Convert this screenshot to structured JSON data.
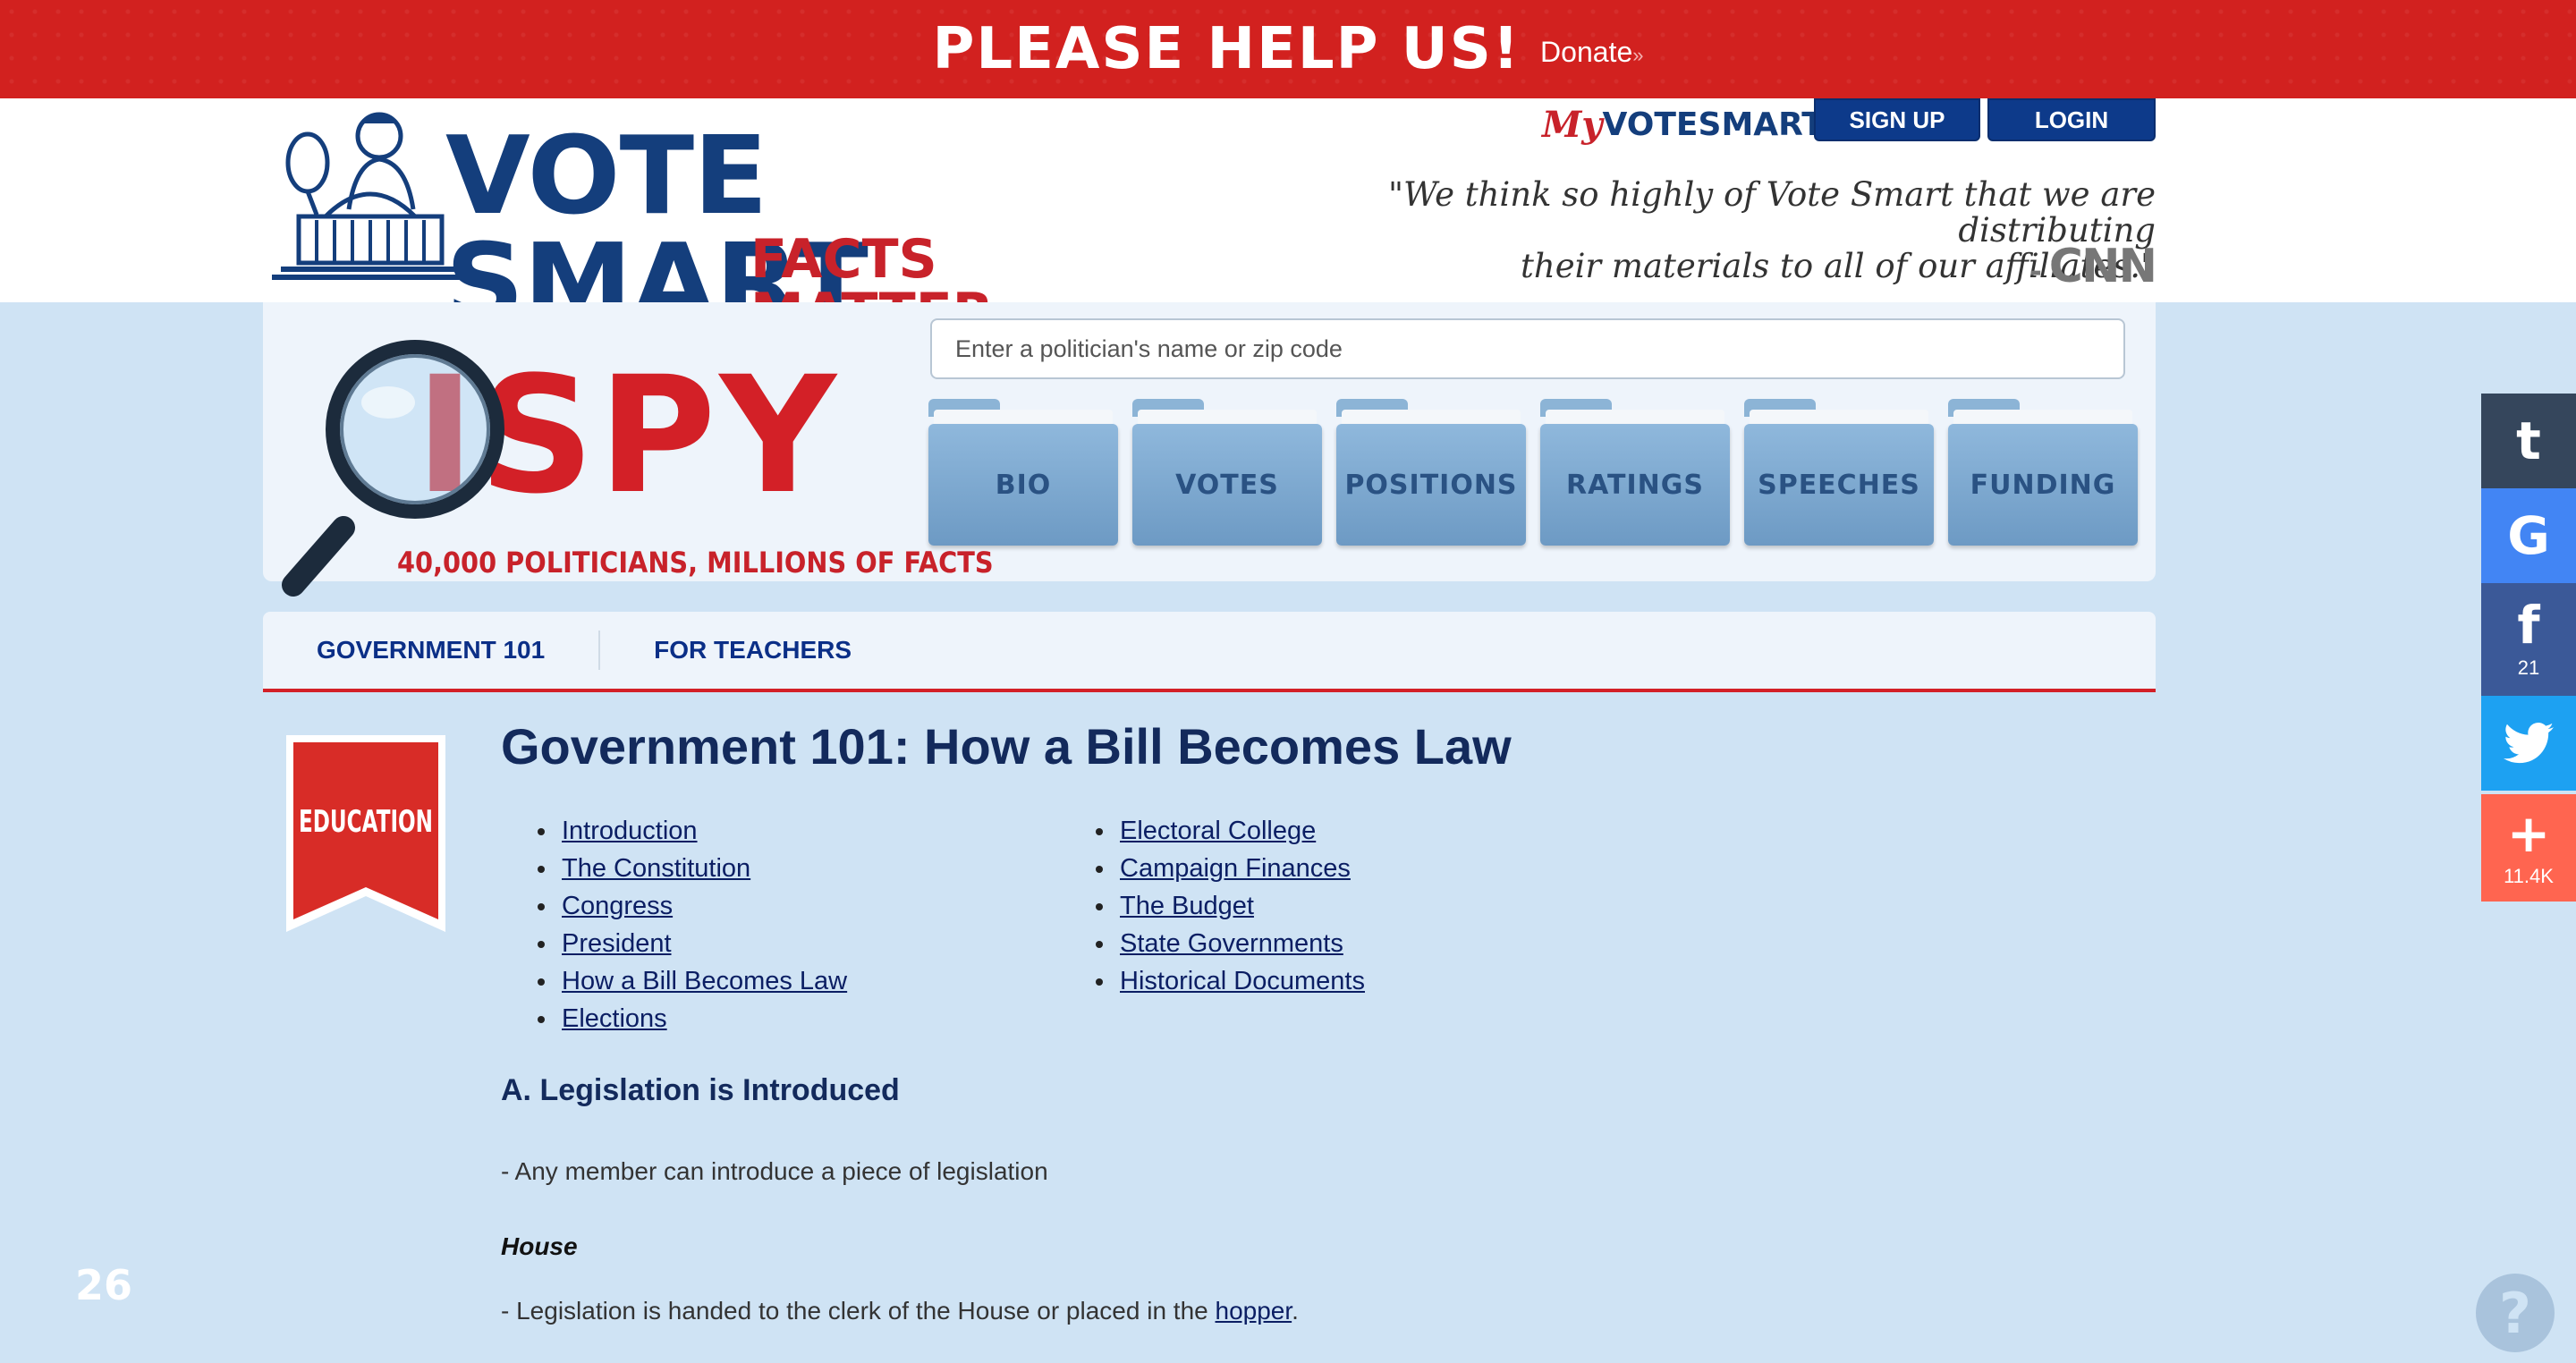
{
  "banner": {
    "headline": "PLEASE HELP US!",
    "donate_label": "Donate",
    "donate_arrow": "»"
  },
  "header": {
    "logo": {
      "line1": "VOTE SMART",
      "line2": "FACTS MATTER"
    },
    "my_votesmart": {
      "my": "My",
      "rest": "VOTESMART"
    },
    "signup_label": "SIGN UP",
    "login_label": "LOGIN",
    "quote_line1": "\"We think so highly of Vote Smart that we are distributing",
    "quote_line2": "their materials to all of our affiliates.\"",
    "quote_source_prefix": "- ",
    "quote_source": "CNN"
  },
  "ispy": {
    "word": "ISPY",
    "tagline": "40,000 POLITICIANS, MILLIONS OF FACTS",
    "search_placeholder": "Enter a politician's name or zip code",
    "folders": [
      "BIO",
      "VOTES",
      "POSITIONS",
      "RATINGS",
      "SPEECHES",
      "FUNDING"
    ]
  },
  "subnav": {
    "items": [
      "GOVERNMENT 101",
      "FOR TEACHERS"
    ]
  },
  "badge": {
    "label": "EDUCATION"
  },
  "content": {
    "title": "Government 101: How a Bill Becomes Law",
    "toc_left": [
      "Introduction",
      "The Constitution",
      "Congress",
      "President",
      "How a Bill Becomes Law",
      "Elections"
    ],
    "toc_right": [
      "Electoral College",
      "Campaign Finances",
      "The Budget",
      "State Governments",
      "Historical Documents"
    ],
    "section_heading": "A. Legislation is Introduced",
    "para1": "- Any member can introduce a piece of legislation",
    "house_label": "House",
    "para2_prefix": "- Legislation is handed to the clerk of the House or placed in the ",
    "para2_link": "hopper",
    "para2_suffix": "."
  },
  "share": {
    "tumblr_glyph": "t",
    "google_glyph": "G",
    "facebook_glyph": "f",
    "facebook_count": "21",
    "twitter_glyph": "🐦",
    "more_glyph": "+",
    "more_count": "11.4K"
  },
  "page_number": "26",
  "help_glyph": "?",
  "colors": {
    "banner_red": "#d2211f",
    "brand_navy": "#143e7c",
    "brand_red": "#c8222a",
    "page_bg": "#cfe3f4"
  }
}
